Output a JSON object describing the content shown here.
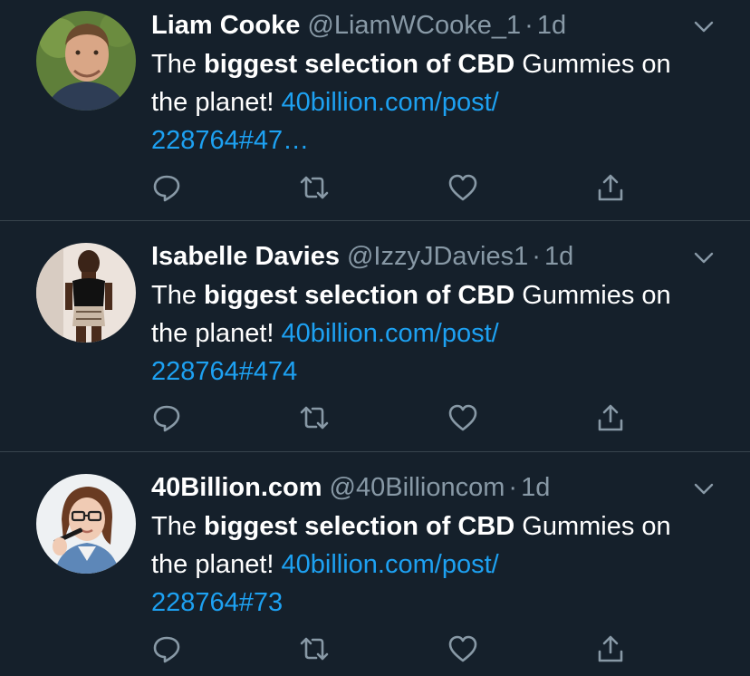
{
  "colors": {
    "background": "#15202b",
    "divider": "#38444d",
    "secondary_text": "#8899a6",
    "link": "#1da1f2"
  },
  "tweets": [
    {
      "name": "Liam Cooke",
      "handle": "@LiamWCooke_1",
      "separator": "·",
      "time": "1d",
      "text_prefix": "The ",
      "text_bold": "biggest selection of CBD",
      "text_suffix": " Gummies on the planet! ",
      "link_line1": "40billion.com/post/",
      "link_line2": "228764#47…",
      "avatar_icon": "avatar-photo-man",
      "menu_icon": "chevron-down-icon"
    },
    {
      "name": "Isabelle Davies",
      "handle": "@IzzyJDavies1",
      "separator": "·",
      "time": "1d",
      "text_prefix": "The ",
      "text_bold": "biggest selection of CBD",
      "text_suffix": " Gummies on the planet! ",
      "link_line1": "40billion.com/post/",
      "link_line2": "228764#474",
      "avatar_icon": "avatar-photo-woman",
      "menu_icon": "chevron-down-icon"
    },
    {
      "name": "40Billion.com",
      "handle": "@40Billioncom",
      "separator": "·",
      "time": "1d",
      "text_prefix": "The ",
      "text_bold": "biggest selection of CBD",
      "text_suffix": " Gummies on the planet! ",
      "link_line1": "40billion.com/post/",
      "link_line2": "228764#73",
      "avatar_icon": "avatar-photo-woman-glasses",
      "menu_icon": "chevron-down-icon"
    }
  ],
  "actions": [
    "reply-icon",
    "retweet-icon",
    "like-icon",
    "share-icon"
  ]
}
